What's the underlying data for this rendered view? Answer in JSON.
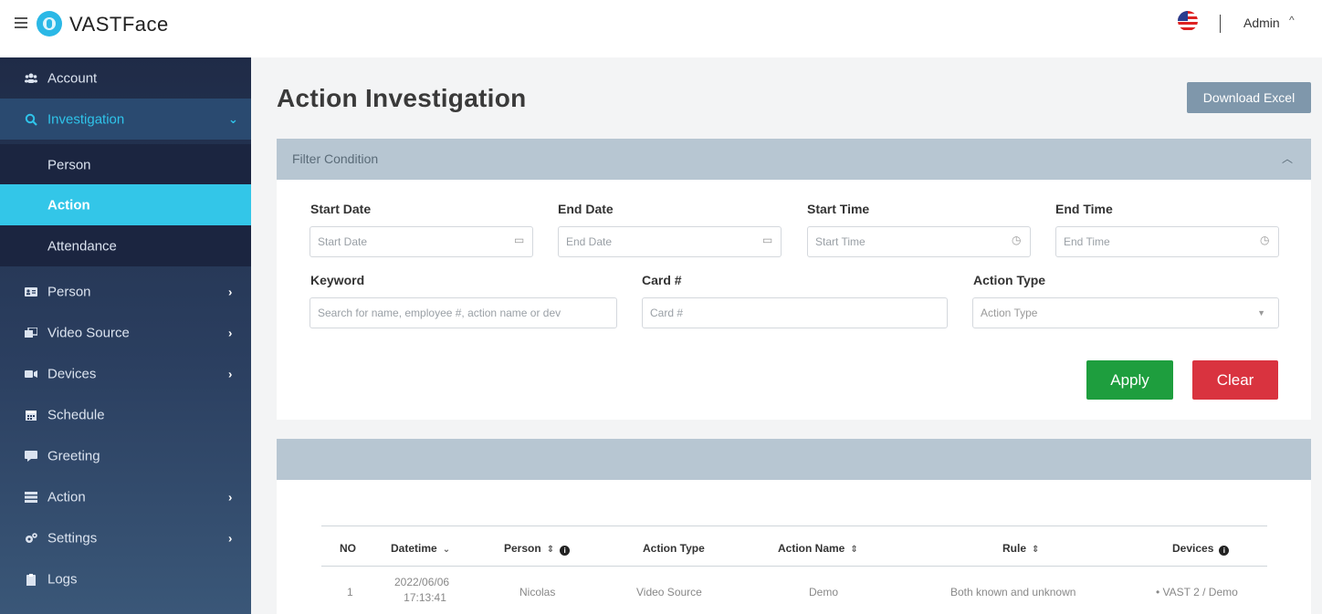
{
  "header": {
    "brand": "VASTFace",
    "user": "Admin",
    "caret": "^"
  },
  "sidebar": {
    "items": [
      {
        "label": "Account",
        "icon": "users-icon"
      },
      {
        "label": "Investigation",
        "icon": "search-icon",
        "chevron": "⌄"
      },
      {
        "label": "Person",
        "sub": true
      },
      {
        "label": "Action",
        "sub": true,
        "active": true
      },
      {
        "label": "Attendance",
        "sub": true
      },
      {
        "label": "Person",
        "icon": "id-card-icon",
        "chevron": "›"
      },
      {
        "label": "Video Source",
        "icon": "video-source-icon",
        "chevron": "›"
      },
      {
        "label": "Devices",
        "icon": "camera-icon",
        "chevron": "›"
      },
      {
        "label": "Schedule",
        "icon": "calendar-icon"
      },
      {
        "label": "Greeting",
        "icon": "comment-icon"
      },
      {
        "label": "Action",
        "icon": "list-icon",
        "chevron": "›"
      },
      {
        "label": "Settings",
        "icon": "cogs-icon",
        "chevron": "›"
      },
      {
        "label": "Logs",
        "icon": "clipboard-icon"
      }
    ]
  },
  "main": {
    "title": "Action Investigation",
    "download_label": "Download Excel"
  },
  "filter": {
    "title": "Filter Condition",
    "start_date_label": "Start Date",
    "start_date_placeholder": "Start Date",
    "end_date_label": "End Date",
    "end_date_placeholder": "End Date",
    "start_time_label": "Start Time",
    "start_time_placeholder": "Start Time",
    "end_time_label": "End Time",
    "end_time_placeholder": "End Time",
    "keyword_label": "Keyword",
    "keyword_placeholder": "Search for name, employee #, action name or dev",
    "card_label": "Card #",
    "card_placeholder": "Card #",
    "action_type_label": "Action Type",
    "action_type_placeholder": "Action Type",
    "apply_label": "Apply",
    "clear_label": "Clear"
  },
  "table": {
    "columns": [
      "NO",
      "Datetime",
      "Person",
      "Action Type",
      "Action Name",
      "Rule",
      "Devices"
    ],
    "rows": [
      {
        "no": "1",
        "date": "2022/06/06",
        "time": "17:13:41",
        "person": "Nicolas",
        "action_type": "Video Source",
        "action_name": "Demo",
        "rule": "Both known and unknown",
        "devices": "• VAST 2 / Demo"
      }
    ]
  },
  "colors": {
    "accent": "#33c6e8",
    "apply": "#1e9e3e",
    "clear": "#d9333f",
    "panel_header": "#b7c6d2",
    "download": "#7f97ab"
  }
}
